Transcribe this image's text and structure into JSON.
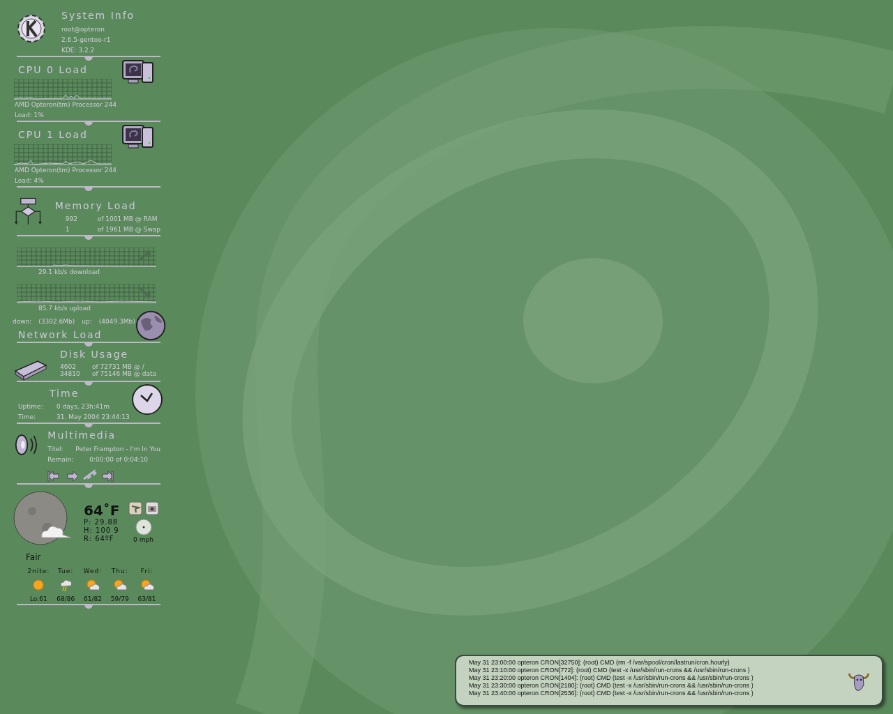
{
  "system_info": {
    "title": "System Info",
    "lines": [
      "root@opteron",
      "2.6.5-gentoo-r1",
      "KDE: 3.2.2"
    ]
  },
  "cpus": [
    {
      "title": "CPU 0 Load",
      "processor": "AMD Opteron(tm) Processor 244",
      "load": "Load: 1%"
    },
    {
      "title": "CPU 1 Load",
      "processor": "AMD Opteron(tm) Processor 244",
      "load": "Load: 4%"
    }
  ],
  "memory": {
    "title": "Memory Load",
    "rows": [
      {
        "used": "992",
        "total": "of 1001 MB @ RAM"
      },
      {
        "used": "1",
        "total": "of 1961 MB @ Swap"
      }
    ]
  },
  "network": {
    "download": "29.1 kb/s download",
    "upload": "85.7 kb/s upload",
    "down_label": "down:",
    "down_value": "(3302.6Mb)",
    "up_label": "up:",
    "up_value": "(4049.3Mb)",
    "title": "Network Load"
  },
  "disk": {
    "title": "Disk Usage",
    "rows": [
      {
        "used": "4602",
        "total": "of 72731 MB @ /"
      },
      {
        "used": "34810",
        "total": "of 75146 MB @ data"
      }
    ]
  },
  "time": {
    "title": "Time",
    "rows": [
      {
        "label": "Uptime:",
        "value": "0 days, 23h:41m"
      },
      {
        "label": "Time:",
        "value": "31. May 2004  23:44:13"
      }
    ]
  },
  "multimedia": {
    "title": "Multimedia",
    "rows": [
      {
        "label": "Titel:",
        "value": "Peter Frampton - I'm In You"
      },
      {
        "label": "Remain:",
        "value": "0:00:00 of 0:04:10"
      }
    ]
  },
  "weather": {
    "temperature": "64˚F",
    "pressure": "P: 29.88",
    "humidity": "H: 100 9",
    "reading": "R: 64ºF",
    "wind": "0 mph",
    "condition": "Fair",
    "forecast": [
      {
        "day": "2nite:",
        "temps": "Lo:61",
        "kind": "sun"
      },
      {
        "day": "Tue:",
        "temps": "68/86",
        "kind": "storm"
      },
      {
        "day": "Wed:",
        "temps": "61/82",
        "kind": "partly"
      },
      {
        "day": "Thu:",
        "temps": "59/79",
        "kind": "partly"
      },
      {
        "day": "Fri:",
        "temps": "63/81",
        "kind": "partly"
      }
    ]
  },
  "log": {
    "lines": [
      "May 31 23:00:00 opteron CRON[32750]: (root) CMD (rm -f /var/spool/cron/lastrun/cron.hourly)",
      "May 31 23:10:00 opteron CRON[772]: (root) CMD (test -x /usr/sbin/run-crons && /usr/sbin/run-crons )",
      "May 31 23:20:00 opteron CRON[1404]: (root) CMD (test -x /usr/sbin/run-crons && /usr/sbin/run-crons )",
      "May 31 23:30:00 opteron CRON[2180]: (root) CMD (test -x /usr/sbin/run-crons && /usr/sbin/run-crons )",
      "May 31 23:40:00 opteron CRON[2536]: (root) CMD (test -x /usr/sbin/run-crons && /usr/sbin/run-crons )"
    ]
  }
}
